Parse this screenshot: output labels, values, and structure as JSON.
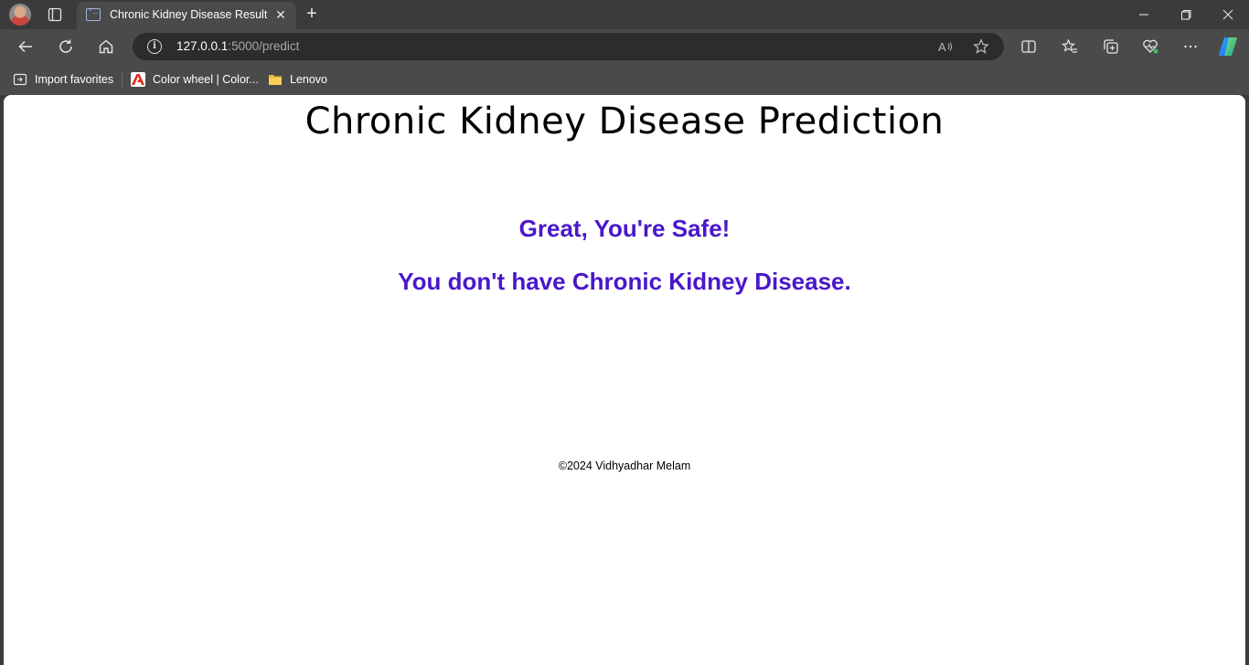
{
  "browser": {
    "tab": {
      "title": "Chronic Kidney Disease Result"
    },
    "address": {
      "host": "127.0.0.1",
      "path": ":5000/predict"
    },
    "favorites": [
      {
        "label": "Import favorites",
        "icon": "import-favorites-icon"
      },
      {
        "label": "Color wheel | Color...",
        "icon": "adobe-icon"
      },
      {
        "label": "Lenovo",
        "icon": "folder-icon"
      }
    ],
    "icons": {
      "back": "arrow-left-icon",
      "refresh": "refresh-icon",
      "home": "home-icon",
      "read_aloud": "read-aloud-icon",
      "favorite": "star-icon",
      "split": "split-screen-icon",
      "favorites": "favorites-icon",
      "collections": "collections-icon",
      "health": "browser-essentials-icon",
      "more": "more-icon",
      "copilot": "copilot-icon"
    },
    "colors": {
      "chrome": "#3b3b3b",
      "toolbar": "#4a4a4a"
    }
  },
  "page": {
    "title": "Chronic Kidney Disease Prediction",
    "result_line_1": "Great, You're Safe!",
    "result_line_2": "You don't have Chronic Kidney Disease.",
    "footer": "©2024 Vidhyadhar Melam",
    "colors": {
      "result": "#4a17c9",
      "background": "#ffffff",
      "text": "#000000"
    }
  }
}
